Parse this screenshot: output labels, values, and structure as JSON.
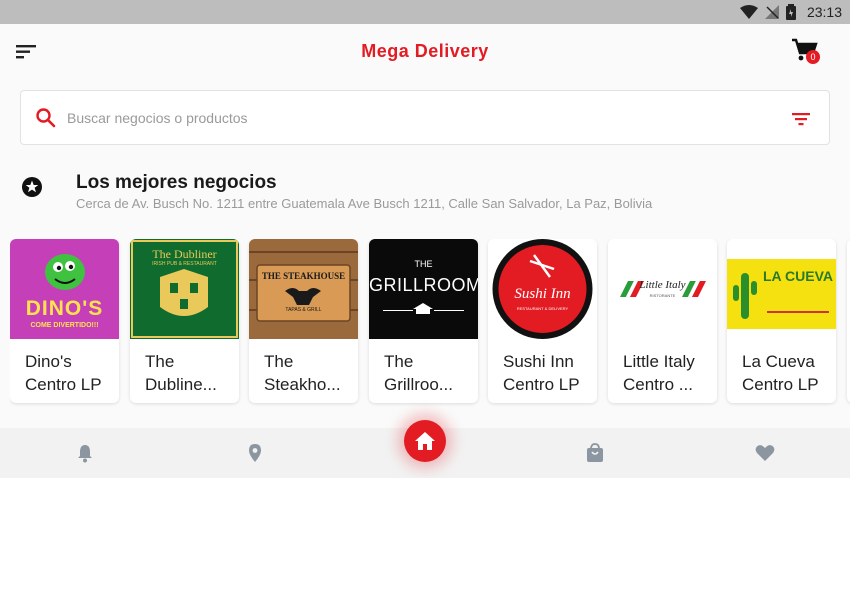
{
  "status_bar": {
    "time": "23:13"
  },
  "app_bar": {
    "title": "Mega Delivery",
    "cart_count": "0"
  },
  "search": {
    "placeholder": "Buscar negocios o productos"
  },
  "section": {
    "title": "Los mejores negocios",
    "address": "Cerca de Av. Busch No. 1211 entre Guatemala Ave Busch 1211, Calle San Salvador, La Paz, Bolivia"
  },
  "businesses": [
    {
      "line1": "Dino's",
      "line2": "Centro LP",
      "logo_text": "DINO'S",
      "logo_sub": "COME DIVERTIDO!!!"
    },
    {
      "line1": "The",
      "line2": "Dubline...",
      "logo_text": "The Dubliner",
      "logo_sub": "IRISH PUB & RESTAURANT"
    },
    {
      "line1": "The",
      "line2": "Steakho...",
      "logo_text": "THE STEAKHOUSE",
      "logo_sub": "TAPAS & GRILL"
    },
    {
      "line1": "The",
      "line2": "Grillroo...",
      "logo_text": "THE",
      "logo_sub": "GRILLROOM"
    },
    {
      "line1": "Sushi Inn",
      "line2": "Centro LP",
      "logo_text": "Sushi Inn",
      "logo_sub": "RESTAURANT & DELIVERY"
    },
    {
      "line1": "Little Italy",
      "line2": "Centro ...",
      "logo_text": "Little Italy",
      "logo_sub": "RISTORANTE"
    },
    {
      "line1": "La Cueva",
      "line2": "Centro LP",
      "logo_text": "LA CUEVA",
      "logo_sub": ""
    }
  ],
  "colors": {
    "brand": "#e31b23",
    "nav_icon": "#8c96a0"
  },
  "bottom_nav": [
    "bell-icon",
    "location-pin-icon",
    "home-icon",
    "shopping-bag-icon",
    "heart-icon"
  ]
}
